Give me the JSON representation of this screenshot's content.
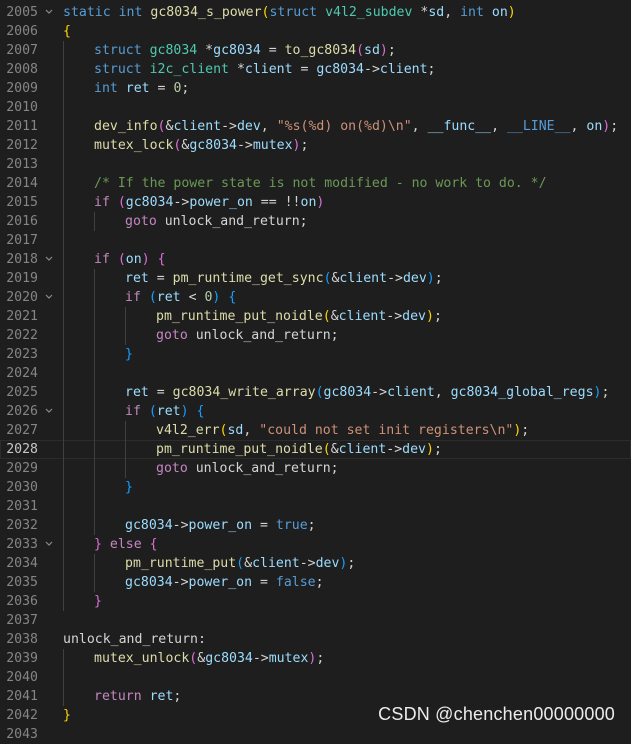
{
  "editor": {
    "current_line": "2028",
    "lines": [
      {
        "num": "2005",
        "indent": 0,
        "fold": true,
        "tokens": [
          {
            "t": "static",
            "c": "keyword"
          },
          {
            "t": " ",
            "c": "plain"
          },
          {
            "t": "int",
            "c": "keyword"
          },
          {
            "t": " ",
            "c": "plain"
          },
          {
            "t": "gc8034_s_power",
            "c": "function"
          },
          {
            "t": "(",
            "c": "bracket1"
          },
          {
            "t": "struct",
            "c": "keyword"
          },
          {
            "t": " ",
            "c": "plain"
          },
          {
            "t": "v4l2_subdev",
            "c": "type"
          },
          {
            "t": " *",
            "c": "plain"
          },
          {
            "t": "sd",
            "c": "variable"
          },
          {
            "t": ", ",
            "c": "plain"
          },
          {
            "t": "int",
            "c": "keyword"
          },
          {
            "t": " ",
            "c": "plain"
          },
          {
            "t": "on",
            "c": "variable"
          },
          {
            "t": ")",
            "c": "bracket1"
          }
        ]
      },
      {
        "num": "2006",
        "indent": 0,
        "fold": false,
        "tokens": [
          {
            "t": "{",
            "c": "bracket1"
          }
        ]
      },
      {
        "num": "2007",
        "indent": 1,
        "fold": false,
        "tokens": [
          {
            "t": "struct",
            "c": "keyword"
          },
          {
            "t": " ",
            "c": "plain"
          },
          {
            "t": "gc8034",
            "c": "type"
          },
          {
            "t": " *",
            "c": "plain"
          },
          {
            "t": "gc8034",
            "c": "variable"
          },
          {
            "t": " = ",
            "c": "plain"
          },
          {
            "t": "to_gc8034",
            "c": "function"
          },
          {
            "t": "(",
            "c": "bracket2"
          },
          {
            "t": "sd",
            "c": "variable"
          },
          {
            "t": ")",
            "c": "bracket2"
          },
          {
            "t": ";",
            "c": "plain"
          }
        ]
      },
      {
        "num": "2008",
        "indent": 1,
        "fold": false,
        "tokens": [
          {
            "t": "struct",
            "c": "keyword"
          },
          {
            "t": " ",
            "c": "plain"
          },
          {
            "t": "i2c_client",
            "c": "type"
          },
          {
            "t": " *",
            "c": "plain"
          },
          {
            "t": "client",
            "c": "variable"
          },
          {
            "t": " = ",
            "c": "plain"
          },
          {
            "t": "gc8034",
            "c": "variable"
          },
          {
            "t": "->",
            "c": "plain"
          },
          {
            "t": "client",
            "c": "variable"
          },
          {
            "t": ";",
            "c": "plain"
          }
        ]
      },
      {
        "num": "2009",
        "indent": 1,
        "fold": false,
        "tokens": [
          {
            "t": "int",
            "c": "keyword"
          },
          {
            "t": " ",
            "c": "plain"
          },
          {
            "t": "ret",
            "c": "variable"
          },
          {
            "t": " = ",
            "c": "plain"
          },
          {
            "t": "0",
            "c": "number"
          },
          {
            "t": ";",
            "c": "plain"
          }
        ]
      },
      {
        "num": "2010",
        "indent": 1,
        "fold": false,
        "tokens": []
      },
      {
        "num": "2011",
        "indent": 1,
        "fold": false,
        "tokens": [
          {
            "t": "dev_info",
            "c": "function"
          },
          {
            "t": "(",
            "c": "bracket2"
          },
          {
            "t": "&",
            "c": "plain"
          },
          {
            "t": "client",
            "c": "variable"
          },
          {
            "t": "->",
            "c": "plain"
          },
          {
            "t": "dev",
            "c": "variable"
          },
          {
            "t": ", ",
            "c": "plain"
          },
          {
            "t": "\"%s(%d) on(%d)\\n\"",
            "c": "string"
          },
          {
            "t": ", ",
            "c": "plain"
          },
          {
            "t": "__func__",
            "c": "variable"
          },
          {
            "t": ", ",
            "c": "plain"
          },
          {
            "t": "__LINE__",
            "c": "macro"
          },
          {
            "t": ", ",
            "c": "plain"
          },
          {
            "t": "on",
            "c": "variable"
          },
          {
            "t": ")",
            "c": "bracket2"
          },
          {
            "t": ";",
            "c": "plain"
          }
        ]
      },
      {
        "num": "2012",
        "indent": 1,
        "fold": false,
        "tokens": [
          {
            "t": "mutex_lock",
            "c": "function"
          },
          {
            "t": "(",
            "c": "bracket2"
          },
          {
            "t": "&",
            "c": "plain"
          },
          {
            "t": "gc8034",
            "c": "variable"
          },
          {
            "t": "->",
            "c": "plain"
          },
          {
            "t": "mutex",
            "c": "variable"
          },
          {
            "t": ")",
            "c": "bracket2"
          },
          {
            "t": ";",
            "c": "plain"
          }
        ]
      },
      {
        "num": "2013",
        "indent": 1,
        "fold": false,
        "tokens": []
      },
      {
        "num": "2014",
        "indent": 1,
        "fold": false,
        "tokens": [
          {
            "t": "/* If the power state is not modified - no work to do. */",
            "c": "comment"
          }
        ]
      },
      {
        "num": "2015",
        "indent": 1,
        "fold": false,
        "tokens": [
          {
            "t": "if",
            "c": "control"
          },
          {
            "t": " ",
            "c": "plain"
          },
          {
            "t": "(",
            "c": "bracket2"
          },
          {
            "t": "gc8034",
            "c": "variable"
          },
          {
            "t": "->",
            "c": "plain"
          },
          {
            "t": "power_on",
            "c": "variable"
          },
          {
            "t": " == !!",
            "c": "plain"
          },
          {
            "t": "on",
            "c": "variable"
          },
          {
            "t": ")",
            "c": "bracket2"
          }
        ]
      },
      {
        "num": "2016",
        "indent": 2,
        "fold": false,
        "tokens": [
          {
            "t": "goto",
            "c": "control"
          },
          {
            "t": " unlock_and_return;",
            "c": "plain"
          }
        ]
      },
      {
        "num": "2017",
        "indent": 1,
        "fold": false,
        "tokens": []
      },
      {
        "num": "2018",
        "indent": 1,
        "fold": true,
        "tokens": [
          {
            "t": "if",
            "c": "control"
          },
          {
            "t": " ",
            "c": "plain"
          },
          {
            "t": "(",
            "c": "bracket2"
          },
          {
            "t": "on",
            "c": "variable"
          },
          {
            "t": ")",
            "c": "bracket2"
          },
          {
            "t": " ",
            "c": "plain"
          },
          {
            "t": "{",
            "c": "bracket2"
          }
        ]
      },
      {
        "num": "2019",
        "indent": 2,
        "fold": false,
        "tokens": [
          {
            "t": "ret",
            "c": "variable"
          },
          {
            "t": " = ",
            "c": "plain"
          },
          {
            "t": "pm_runtime_get_sync",
            "c": "function"
          },
          {
            "t": "(",
            "c": "bracket3"
          },
          {
            "t": "&",
            "c": "plain"
          },
          {
            "t": "client",
            "c": "variable"
          },
          {
            "t": "->",
            "c": "plain"
          },
          {
            "t": "dev",
            "c": "variable"
          },
          {
            "t": ")",
            "c": "bracket3"
          },
          {
            "t": ";",
            "c": "plain"
          }
        ]
      },
      {
        "num": "2020",
        "indent": 2,
        "fold": true,
        "tokens": [
          {
            "t": "if",
            "c": "control"
          },
          {
            "t": " ",
            "c": "plain"
          },
          {
            "t": "(",
            "c": "bracket3"
          },
          {
            "t": "ret",
            "c": "variable"
          },
          {
            "t": " < ",
            "c": "plain"
          },
          {
            "t": "0",
            "c": "number"
          },
          {
            "t": ")",
            "c": "bracket3"
          },
          {
            "t": " ",
            "c": "plain"
          },
          {
            "t": "{",
            "c": "bracket3"
          }
        ]
      },
      {
        "num": "2021",
        "indent": 3,
        "fold": false,
        "tokens": [
          {
            "t": "pm_runtime_put_noidle",
            "c": "function"
          },
          {
            "t": "(",
            "c": "bracket1"
          },
          {
            "t": "&",
            "c": "plain"
          },
          {
            "t": "client",
            "c": "variable"
          },
          {
            "t": "->",
            "c": "plain"
          },
          {
            "t": "dev",
            "c": "variable"
          },
          {
            "t": ")",
            "c": "bracket1"
          },
          {
            "t": ";",
            "c": "plain"
          }
        ]
      },
      {
        "num": "2022",
        "indent": 3,
        "fold": false,
        "tokens": [
          {
            "t": "goto",
            "c": "control"
          },
          {
            "t": " unlock_and_return;",
            "c": "plain"
          }
        ]
      },
      {
        "num": "2023",
        "indent": 2,
        "fold": false,
        "tokens": [
          {
            "t": "}",
            "c": "bracket3"
          }
        ]
      },
      {
        "num": "2024",
        "indent": 2,
        "fold": false,
        "tokens": []
      },
      {
        "num": "2025",
        "indent": 2,
        "fold": false,
        "tokens": [
          {
            "t": "ret",
            "c": "variable"
          },
          {
            "t": " = ",
            "c": "plain"
          },
          {
            "t": "gc8034_write_array",
            "c": "function"
          },
          {
            "t": "(",
            "c": "bracket3"
          },
          {
            "t": "gc8034",
            "c": "variable"
          },
          {
            "t": "->",
            "c": "plain"
          },
          {
            "t": "client",
            "c": "variable"
          },
          {
            "t": ", ",
            "c": "plain"
          },
          {
            "t": "gc8034_global_regs",
            "c": "variable"
          },
          {
            "t": ")",
            "c": "bracket3"
          },
          {
            "t": ";",
            "c": "plain"
          }
        ]
      },
      {
        "num": "2026",
        "indent": 2,
        "fold": true,
        "tokens": [
          {
            "t": "if",
            "c": "control"
          },
          {
            "t": " ",
            "c": "plain"
          },
          {
            "t": "(",
            "c": "bracket3"
          },
          {
            "t": "ret",
            "c": "variable"
          },
          {
            "t": ")",
            "c": "bracket3"
          },
          {
            "t": " ",
            "c": "plain"
          },
          {
            "t": "{",
            "c": "bracket3"
          }
        ]
      },
      {
        "num": "2027",
        "indent": 3,
        "fold": false,
        "tokens": [
          {
            "t": "v4l2_err",
            "c": "function"
          },
          {
            "t": "(",
            "c": "bracket1"
          },
          {
            "t": "sd",
            "c": "variable"
          },
          {
            "t": ", ",
            "c": "plain"
          },
          {
            "t": "\"could not set init registers\\n\"",
            "c": "string"
          },
          {
            "t": ")",
            "c": "bracket1"
          },
          {
            "t": ";",
            "c": "plain"
          }
        ]
      },
      {
        "num": "2028",
        "indent": 3,
        "fold": false,
        "tokens": [
          {
            "t": "pm_runtime_put_noidle",
            "c": "function"
          },
          {
            "t": "(",
            "c": "bracket1"
          },
          {
            "t": "&",
            "c": "plain"
          },
          {
            "t": "client",
            "c": "variable"
          },
          {
            "t": "->",
            "c": "plain"
          },
          {
            "t": "dev",
            "c": "variable"
          },
          {
            "t": ")",
            "c": "bracket1"
          },
          {
            "t": ";",
            "c": "plain"
          }
        ]
      },
      {
        "num": "2029",
        "indent": 3,
        "fold": false,
        "tokens": [
          {
            "t": "goto",
            "c": "control"
          },
          {
            "t": " unlock_and_return;",
            "c": "plain"
          }
        ]
      },
      {
        "num": "2030",
        "indent": 2,
        "fold": false,
        "tokens": [
          {
            "t": "}",
            "c": "bracket3"
          }
        ]
      },
      {
        "num": "2031",
        "indent": 2,
        "fold": false,
        "tokens": []
      },
      {
        "num": "2032",
        "indent": 2,
        "fold": false,
        "tokens": [
          {
            "t": "gc8034",
            "c": "variable"
          },
          {
            "t": "->",
            "c": "plain"
          },
          {
            "t": "power_on",
            "c": "variable"
          },
          {
            "t": " = ",
            "c": "plain"
          },
          {
            "t": "true",
            "c": "keyword"
          },
          {
            "t": ";",
            "c": "plain"
          }
        ]
      },
      {
        "num": "2033",
        "indent": 1,
        "fold": true,
        "tokens": [
          {
            "t": "}",
            "c": "bracket2"
          },
          {
            "t": " ",
            "c": "plain"
          },
          {
            "t": "else",
            "c": "control"
          },
          {
            "t": " ",
            "c": "plain"
          },
          {
            "t": "{",
            "c": "bracket2"
          }
        ]
      },
      {
        "num": "2034",
        "indent": 2,
        "fold": false,
        "tokens": [
          {
            "t": "pm_runtime_put",
            "c": "function"
          },
          {
            "t": "(",
            "c": "bracket3"
          },
          {
            "t": "&",
            "c": "plain"
          },
          {
            "t": "client",
            "c": "variable"
          },
          {
            "t": "->",
            "c": "plain"
          },
          {
            "t": "dev",
            "c": "variable"
          },
          {
            "t": ")",
            "c": "bracket3"
          },
          {
            "t": ";",
            "c": "plain"
          }
        ]
      },
      {
        "num": "2035",
        "indent": 2,
        "fold": false,
        "tokens": [
          {
            "t": "gc8034",
            "c": "variable"
          },
          {
            "t": "->",
            "c": "plain"
          },
          {
            "t": "power_on",
            "c": "variable"
          },
          {
            "t": " = ",
            "c": "plain"
          },
          {
            "t": "false",
            "c": "keyword"
          },
          {
            "t": ";",
            "c": "plain"
          }
        ]
      },
      {
        "num": "2036",
        "indent": 1,
        "fold": false,
        "tokens": [
          {
            "t": "}",
            "c": "bracket2"
          }
        ]
      },
      {
        "num": "2037",
        "indent": 0,
        "fold": false,
        "tokens": []
      },
      {
        "num": "2038",
        "indent": 0,
        "fold": false,
        "tokens": [
          {
            "t": "unlock_and_return:",
            "c": "plain"
          }
        ]
      },
      {
        "num": "2039",
        "indent": 1,
        "fold": false,
        "tokens": [
          {
            "t": "mutex_unlock",
            "c": "function"
          },
          {
            "t": "(",
            "c": "bracket2"
          },
          {
            "t": "&",
            "c": "plain"
          },
          {
            "t": "gc8034",
            "c": "variable"
          },
          {
            "t": "->",
            "c": "plain"
          },
          {
            "t": "mutex",
            "c": "variable"
          },
          {
            "t": ")",
            "c": "bracket2"
          },
          {
            "t": ";",
            "c": "plain"
          }
        ]
      },
      {
        "num": "2040",
        "indent": 1,
        "fold": false,
        "tokens": []
      },
      {
        "num": "2041",
        "indent": 1,
        "fold": false,
        "tokens": [
          {
            "t": "return",
            "c": "control"
          },
          {
            "t": " ",
            "c": "plain"
          },
          {
            "t": "ret",
            "c": "variable"
          },
          {
            "t": ";",
            "c": "plain"
          }
        ]
      },
      {
        "num": "2042",
        "indent": 0,
        "fold": false,
        "tokens": [
          {
            "t": "}",
            "c": "bracket1"
          }
        ]
      },
      {
        "num": "2043",
        "indent": 0,
        "fold": false,
        "tokens": []
      }
    ]
  },
  "fold_icon": "chevron-down-icon",
  "colors": {
    "background": "#1e1e1e",
    "keyword": "#569cd6",
    "control": "#c586c0",
    "function": "#dcdcaa",
    "variable": "#9cdcfe",
    "type": "#4ec9b0",
    "string": "#ce9178",
    "comment": "#6a9955",
    "number": "#b5cea8"
  },
  "watermark": {
    "text": "CSDN @chenchen00000000"
  }
}
